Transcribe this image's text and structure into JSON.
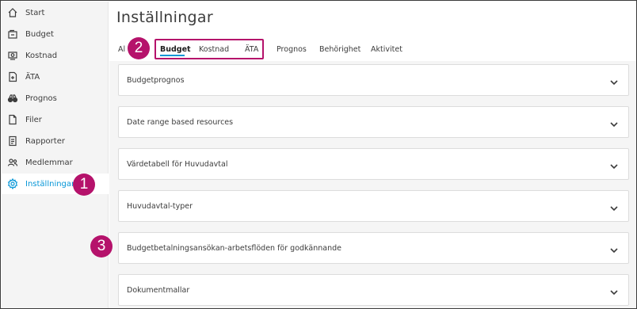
{
  "sidebar": {
    "items": [
      {
        "label": "Start",
        "icon": "home-icon"
      },
      {
        "label": "Budget",
        "icon": "budget-icon"
      },
      {
        "label": "Kostnad",
        "icon": "cost-icon"
      },
      {
        "label": "ÄTA",
        "icon": "change-order-icon"
      },
      {
        "label": "Prognos",
        "icon": "binoculars-icon"
      },
      {
        "label": "Filer",
        "icon": "file-icon"
      },
      {
        "label": "Rapporter",
        "icon": "report-icon"
      },
      {
        "label": "Medlemmar",
        "icon": "members-icon"
      },
      {
        "label": "Inställningar",
        "icon": "gear-icon",
        "active": true
      }
    ]
  },
  "page": {
    "title": "Inställningar"
  },
  "tabs": [
    {
      "label": "Al"
    },
    {
      "label": "Budget",
      "active": true
    },
    {
      "label": "Kostnad"
    },
    {
      "label": "ÄTA"
    },
    {
      "label": "Prognos"
    },
    {
      "label": "Behörighet"
    },
    {
      "label": "Aktivitet"
    }
  ],
  "panels": [
    {
      "label": "Budgetprognos"
    },
    {
      "label": "Date range based resources"
    },
    {
      "label": "Värdetabell för Huvudavtal"
    },
    {
      "label": "Huvudavtal-typer"
    },
    {
      "label": "Budgetbetalningsansökan-arbetsflöden för godkännande"
    },
    {
      "label": "Dokumentmallar"
    }
  ],
  "steps": [
    "1",
    "2",
    "3"
  ],
  "colors": {
    "accent": "#0696d7",
    "callout": "#b5126b",
    "sidebar_bg": "#f4f4f4",
    "text": "#3c3c3c"
  }
}
